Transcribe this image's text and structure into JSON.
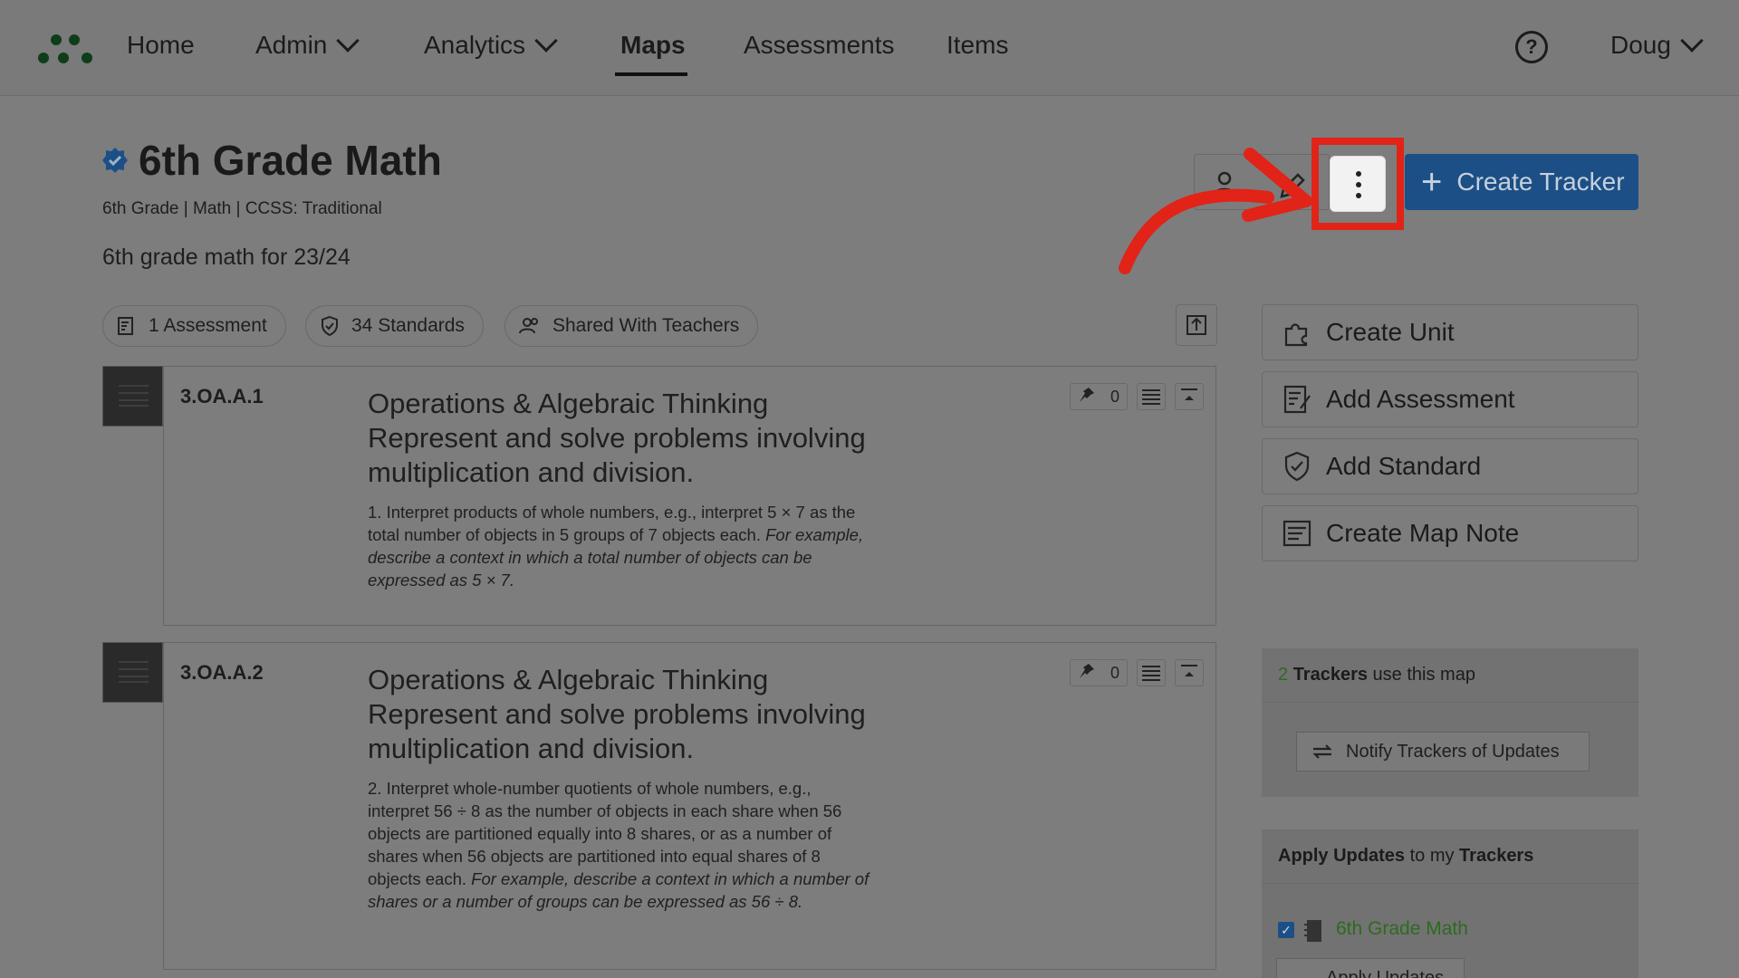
{
  "nav": {
    "items": [
      {
        "label": "Home"
      },
      {
        "label": "Admin"
      },
      {
        "label": "Analytics"
      },
      {
        "label": "Maps"
      },
      {
        "label": "Assessments"
      },
      {
        "label": "Items"
      }
    ],
    "help_glyph": "?",
    "user": "Doug"
  },
  "header": {
    "title": "6th Grade Math",
    "meta": "6th Grade  |  Math  |  CCSS: Traditional",
    "description": "6th grade math for 23/24",
    "create_tracker_label": "Create Tracker",
    "plus_glyph": "+"
  },
  "pills": [
    {
      "label": "1 Assessment"
    },
    {
      "label": "34 Standards"
    },
    {
      "label": "Shared With Teachers"
    }
  ],
  "standards": [
    {
      "code": "3.OA.A.1",
      "domain": "Operations & Algebraic Thinking",
      "cluster": "Represent and solve problems involving multiplication and division.",
      "text": "1. Interpret products of whole numbers, e.g., interpret 5 × 7 as the total number of objects in 5 groups of 7 objects each.",
      "example": "For example, describe a context in which a total number of objects can be expressed as 5 × 7.",
      "pin_count": "0"
    },
    {
      "code": "3.OA.A.2",
      "domain": "Operations & Algebraic Thinking",
      "cluster": "Represent and solve problems involving multiplication and division.",
      "text": "2. Interpret whole-number quotients of whole numbers, e.g., interpret 56 ÷ 8 as the number of objects in each share when 56 objects are partitioned equally into 8 shares, or as a number of shares when 56 objects are partitioned into equal shares of 8 objects each.",
      "example": "For example, describe a context in which a number of shares or a number of groups can be expressed as 56 ÷ 8.",
      "pin_count": "0"
    }
  ],
  "sidebar": {
    "actions": [
      {
        "label": "Create Unit",
        "icon": "puzzle-icon"
      },
      {
        "label": "Add Assessment",
        "icon": "assessment-icon"
      },
      {
        "label": "Add Standard",
        "icon": "shield-check-icon"
      },
      {
        "label": "Create Map Note",
        "icon": "note-icon"
      }
    ],
    "trackers_panel": {
      "count": "2",
      "bold": "Trackers",
      "rest": " use this map",
      "notify_label": "Notify Trackers of Updates"
    },
    "apply_panel": {
      "bold1": "Apply Updates",
      "mid": " to my ",
      "bold2": "Trackers",
      "tracker_name": "6th Grade Math",
      "checkmark": "✓",
      "apply_label": "Apply Updates"
    }
  },
  "colors": {
    "primary": "#1c4f86",
    "highlight": "#e12318",
    "green": "#2d6b1f"
  }
}
